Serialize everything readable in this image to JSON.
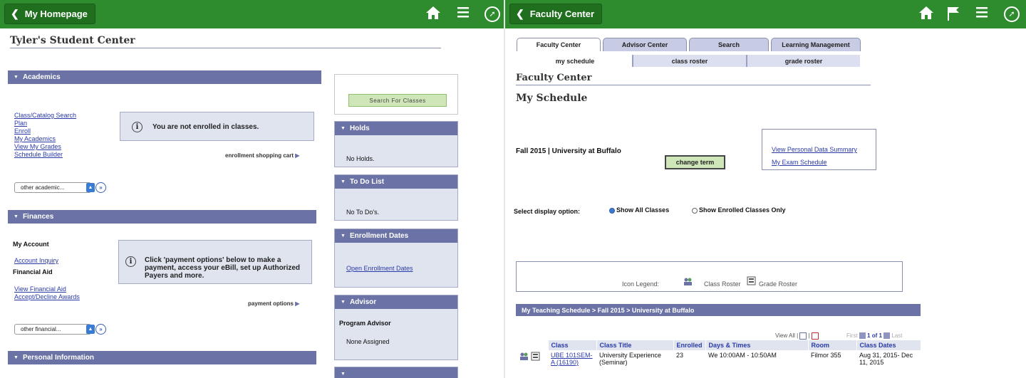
{
  "left": {
    "back_label": "My Homepage",
    "page_title": "Tyler's Student Center",
    "academics": {
      "header": "Academics",
      "links": [
        "Class/Catalog Search",
        "Plan",
        "Enroll",
        "My Academics",
        "View My Grades",
        "Schedule Builder"
      ],
      "info": "You are not enrolled in classes.",
      "cart_link": "enrollment shopping cart",
      "dropdown": "other academic..."
    },
    "finances": {
      "header": "Finances",
      "my_account": "My Account",
      "account_inquiry": "Account Inquiry",
      "financial_aid": "Financial Aid",
      "view_aid": "View Financial Aid",
      "accept_decline": "Accept/Decline Awards",
      "info": "Click 'payment options' below to make a payment, access your eBill, set up Authorized Payers and more.",
      "payment_link": "payment options",
      "dropdown": "other financial..."
    },
    "personal": {
      "header": "Personal Information"
    },
    "search_button": "Search For Classes",
    "holds": {
      "header": "Holds",
      "body": "No Holds."
    },
    "todo": {
      "header": "To Do List",
      "body": "No To Do's."
    },
    "enroll_dates": {
      "header": "Enrollment Dates",
      "link": "Open Enrollment Dates"
    },
    "advisor": {
      "header": "Advisor",
      "title": "Program Advisor",
      "body": "None Assigned"
    }
  },
  "right": {
    "back_label": "Faculty Center",
    "tabs": [
      "Faculty Center",
      "Advisor Center",
      "Search",
      "Learning Management"
    ],
    "subtabs": [
      "my schedule",
      "class roster",
      "grade roster"
    ],
    "section_title": "Faculty Center",
    "page_title": "My Schedule",
    "term": "Fall 2015 | University at Buffalo",
    "change_term": "change term",
    "personal_data_link": "View Personal Data Summary",
    "exam_link": "My Exam Schedule",
    "display_option_label": "Select display option:",
    "radio_all": "Show All Classes",
    "radio_enrolled": "Show Enrolled Classes Only",
    "legend_label": "Icon Legend:",
    "legend_class_roster": "Class Roster",
    "legend_grade_roster": "Grade Roster",
    "teaching_header": "My Teaching Schedule > Fall 2015 > University at Buffalo",
    "view_all": "View All",
    "first": "First",
    "page": "1 of 1",
    "last": "Last",
    "columns": [
      "Class",
      "Class Title",
      "Enrolled",
      "Days & Times",
      "Room",
      "Class Dates"
    ],
    "row": {
      "class": "UBE 101SEM-A (16190)",
      "title": "University Experience (Seminar)",
      "enrolled": "23",
      "days_times": "We 10:00AM - 10:50AM",
      "room": "Filmor 355",
      "dates": "Aug 31, 2015- Dec 11, 2015"
    }
  },
  "colors": {
    "topbar": "#2e8b2e",
    "section_header": "#6b72a6",
    "panel_bg": "#dfe4ef",
    "link": "#2a3aa8"
  }
}
